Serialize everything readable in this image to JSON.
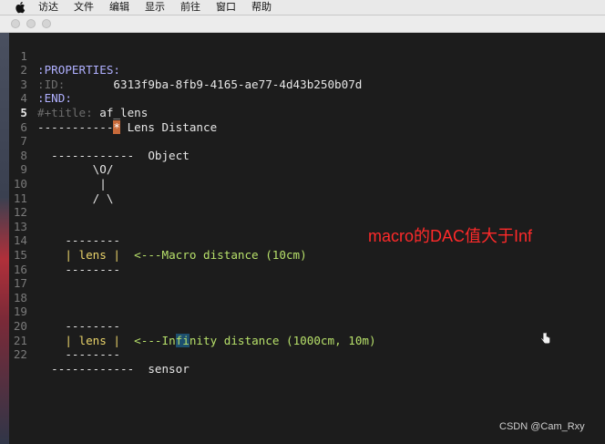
{
  "menubar": {
    "items": [
      "访达",
      "文件",
      "编辑",
      "显示",
      "前往",
      "窗口",
      "帮助"
    ]
  },
  "editor": {
    "lines": [
      {
        "n": "1",
        "parts": [
          ":PROPERTIES:"
        ]
      },
      {
        "n": "2",
        "parts": [
          ":ID:",
          "       6313f9ba-8fb9-4165-ae77-4d43b250b07d"
        ]
      },
      {
        "n": "3",
        "parts": [
          ":END:"
        ]
      },
      {
        "n": "4",
        "parts": [
          "#+title:",
          " af_lens"
        ]
      },
      {
        "n": "5",
        "parts": [
          "-----------",
          "*",
          " Lens Distance"
        ]
      },
      {
        "n": "6",
        "parts": [
          ""
        ]
      },
      {
        "n": "7",
        "parts": [
          "  ------------  Object"
        ]
      },
      {
        "n": "8",
        "parts": [
          "        \\O/"
        ]
      },
      {
        "n": "9",
        "parts": [
          "         |"
        ]
      },
      {
        "n": "10",
        "parts": [
          "        / \\"
        ]
      },
      {
        "n": "11",
        "parts": [
          ""
        ]
      },
      {
        "n": "12",
        "parts": [
          ""
        ]
      },
      {
        "n": "13",
        "parts": [
          "    --------"
        ]
      },
      {
        "n": "14",
        "parts": [
          "    | lens |",
          "  <---Macro distance (10cm)"
        ]
      },
      {
        "n": "15",
        "parts": [
          "    --------"
        ]
      },
      {
        "n": "16",
        "parts": [
          ""
        ]
      },
      {
        "n": "17",
        "parts": [
          ""
        ]
      },
      {
        "n": "18",
        "parts": [
          ""
        ]
      },
      {
        "n": "19",
        "parts": [
          "    --------"
        ]
      },
      {
        "n": "20",
        "parts": [
          "    | lens |",
          "  <---In",
          "fi",
          "nity distance (1000cm, 10m)"
        ]
      },
      {
        "n": "21",
        "parts": [
          "    --------"
        ]
      },
      {
        "n": "22",
        "parts": [
          "  ------------  sensor"
        ]
      }
    ]
  },
  "annotation": "macro的DAC值大于Inf",
  "watermark": "CSDN @Cam_Rxy"
}
